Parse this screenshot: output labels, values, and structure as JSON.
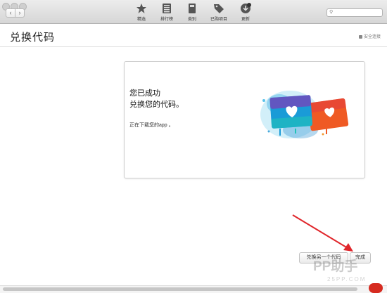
{
  "toolbar": {
    "nav_back": "‹",
    "nav_forward": "›",
    "tabs": [
      {
        "label": "精选",
        "icon": "star-icon"
      },
      {
        "label": "排行榜",
        "icon": "list-icon"
      },
      {
        "label": "类别",
        "icon": "categories-icon"
      },
      {
        "label": "已购项目",
        "icon": "purchased-tag-icon"
      },
      {
        "label": "更新",
        "icon": "updates-badge-icon"
      }
    ],
    "search": {
      "placeholder": "",
      "icon": "search-icon"
    }
  },
  "header": {
    "title": "兑换代码",
    "secure_label": "安全连接"
  },
  "card": {
    "line1": "您已成功",
    "line2": "兑换您的代码。",
    "status": "正在下载您的app 。",
    "art": "itunes-gift-cards-illustration"
  },
  "footer": {
    "redeem_another": "兑换另一个代码",
    "done": "完成"
  },
  "watermark": {
    "brand": "PP助手",
    "url": "25PP.COM"
  },
  "colors": {
    "card_blue": "#1a9bd7",
    "card_orange": "#ef5a24",
    "annotation_arrow": "#e0262b"
  }
}
